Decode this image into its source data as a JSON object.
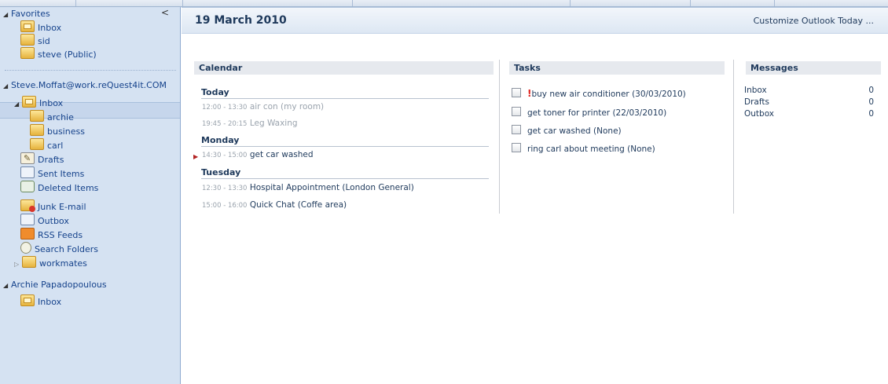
{
  "nav": {
    "collapse_glyph": "<",
    "favorites": {
      "label": "Favorites",
      "items": [
        {
          "label": "Inbox",
          "icon": "inbox-icon"
        },
        {
          "label": "sid",
          "icon": "folder-icon"
        },
        {
          "label": "steve (Public)",
          "icon": "folder-icon"
        }
      ]
    },
    "account1": {
      "label": "Steve.Moffat@work.reQuest4it.COM",
      "inbox": "Inbox",
      "inbox_children": [
        "archie",
        "business",
        "carl"
      ],
      "folders": [
        {
          "label": "Drafts",
          "icon": "drafts-icon"
        },
        {
          "label": "Sent Items",
          "icon": "sent-items-icon"
        },
        {
          "label": "Deleted Items",
          "icon": "deleted-items-icon"
        },
        {
          "label": "Junk E-mail",
          "icon": "junk-email-icon"
        },
        {
          "label": "Outbox",
          "icon": "outbox-icon"
        },
        {
          "label": "RSS Feeds",
          "icon": "rss-icon"
        },
        {
          "label": "Search Folders",
          "icon": "search-folder-icon"
        },
        {
          "label": "workmates",
          "icon": "folder-icon"
        }
      ]
    },
    "account2": {
      "label": "Archie Papadopoulous",
      "inbox": "Inbox"
    }
  },
  "main": {
    "date": "19 March 2010",
    "customize": "Customize Outlook Today ...",
    "calendar": {
      "title": "Calendar",
      "days": [
        {
          "label": "Today",
          "items": [
            {
              "time": "12:00 - 13:30",
              "text": "air con (my room)",
              "past": true
            },
            {
              "time": "19:45 - 20:15",
              "text": "Leg Waxing",
              "past": true
            }
          ]
        },
        {
          "label": "Monday",
          "items": [
            {
              "time": "14:30 - 15:00",
              "text": "get car washed",
              "past": false
            }
          ]
        },
        {
          "label": "Tuesday",
          "items": [
            {
              "time": "12:30 - 13:30",
              "text": "Hospital Appointment (London General)",
              "past": false
            },
            {
              "time": "15:00 - 16:00",
              "text": "Quick Chat (Coffe area)",
              "past": false
            }
          ]
        }
      ]
    },
    "tasks": {
      "title": "Tasks",
      "items": [
        {
          "text": "buy new air conditioner (30/03/2010)",
          "important": true,
          "important_mark": "!"
        },
        {
          "text": "get toner for printer (22/03/2010)",
          "important": false
        },
        {
          "text": "get car washed (None)",
          "important": false
        },
        {
          "text": "ring carl about meeting (None)",
          "important": false
        }
      ]
    },
    "messages": {
      "title": "Messages",
      "rows": [
        {
          "label": "Inbox",
          "count": "0"
        },
        {
          "label": "Drafts",
          "count": "0"
        },
        {
          "label": "Outbox",
          "count": "0"
        }
      ]
    }
  }
}
